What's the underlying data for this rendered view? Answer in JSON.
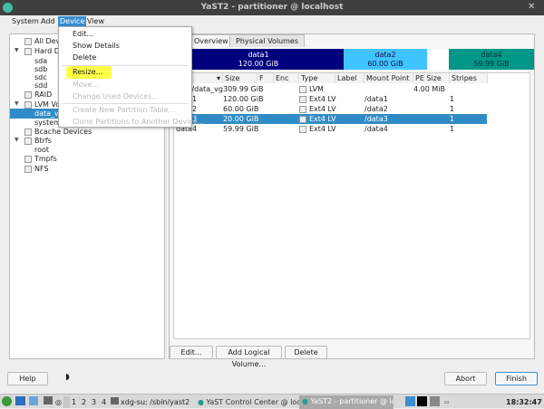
{
  "window": {
    "title": "YaST2 - partitioner @ localhost"
  },
  "menubar": [
    "System",
    "Add",
    "Device",
    "View"
  ],
  "device_menu": [
    {
      "label": "Edit...",
      "enabled": true
    },
    {
      "label": "Show Details",
      "enabled": true
    },
    {
      "label": "Delete",
      "enabled": true
    },
    {
      "label": "Resize...",
      "enabled": true,
      "highlighted": true
    },
    {
      "label": "Move...",
      "enabled": false
    },
    {
      "label": "Change Used Devices...",
      "enabled": false
    },
    {
      "label": "Create New Partition Table...",
      "enabled": false
    },
    {
      "label": "Clone Partitions to Another Device...",
      "enabled": false
    }
  ],
  "tree": [
    {
      "label": "All Devices",
      "icon": "computer-icon"
    },
    {
      "label": "Hard Disks",
      "icon": "disk-icon",
      "expanded": true
    },
    {
      "label": "sda"
    },
    {
      "label": "sdb"
    },
    {
      "label": "sdc"
    },
    {
      "label": "sdd"
    },
    {
      "label": "RAID",
      "icon": "raid-icon"
    },
    {
      "label": "LVM Volume Groups",
      "icon": "lvm-icon",
      "expanded": true
    },
    {
      "label": "data_vg",
      "selected": true
    },
    {
      "label": "system_vg"
    },
    {
      "label": "Bcache Devices",
      "icon": "bcache-icon"
    },
    {
      "label": "Btrfs",
      "icon": "btrfs-icon",
      "expanded": true
    },
    {
      "label": "root"
    },
    {
      "label": "Tmpfs",
      "icon": "tmpfs-icon"
    },
    {
      "label": "NFS",
      "icon": "nfs-icon"
    }
  ],
  "tabs": [
    "Overview",
    "Physical Volumes"
  ],
  "bar": [
    {
      "name": "data1",
      "size": "120.00 GiB",
      "color": "#00007f"
    },
    {
      "name": "data2",
      "size": "60.00 GiB",
      "color": "#40c4ff"
    },
    {
      "name": "",
      "size": "",
      "color": "#ffffff"
    },
    {
      "name": "data4",
      "size": "59.99 GiB",
      "color": "#009688"
    }
  ],
  "table": {
    "columns": [
      "",
      "Size",
      "F",
      "Enc",
      "Type",
      "Label",
      "Mount Point",
      "PE Size",
      "Stripes"
    ],
    "rows": [
      [
        "/dev/data_vg",
        "309.99 GiB",
        "",
        "",
        "LVM",
        "",
        "",
        "4.00 MiB",
        ""
      ],
      [
        "data1",
        "120.00 GiB",
        "",
        "",
        "Ext4 LV",
        "",
        "/data1",
        "",
        "1"
      ],
      [
        "data2",
        "60.00 GiB",
        "",
        "",
        "Ext4 LV",
        "",
        "/data2",
        "",
        "1"
      ],
      [
        "data3",
        "20.00 GiB",
        "",
        "",
        "Ext4 LV",
        "",
        "/data3",
        "",
        "1"
      ],
      [
        "data4",
        "59.99 GiB",
        "",
        "",
        "Ext4 LV",
        "",
        "/data4",
        "",
        "1"
      ]
    ],
    "selected_row": 3
  },
  "buttons": {
    "edit": "Edit...",
    "add_lv": "Add Logical Volume...",
    "delete": "Delete",
    "help": "Help",
    "abort": "Abort",
    "finish": "Finish"
  },
  "taskbar": {
    "desktops": [
      "1",
      "2",
      "3",
      "4"
    ],
    "tasks": [
      "xdg-su: /sbin/yast2",
      "YaST Control Center @ localhost",
      "YaST2 - partitioner @ localho..."
    ],
    "clock": "18:32:47"
  },
  "colors": {
    "selection": "#308cc6",
    "highlight": "#ffff00"
  }
}
